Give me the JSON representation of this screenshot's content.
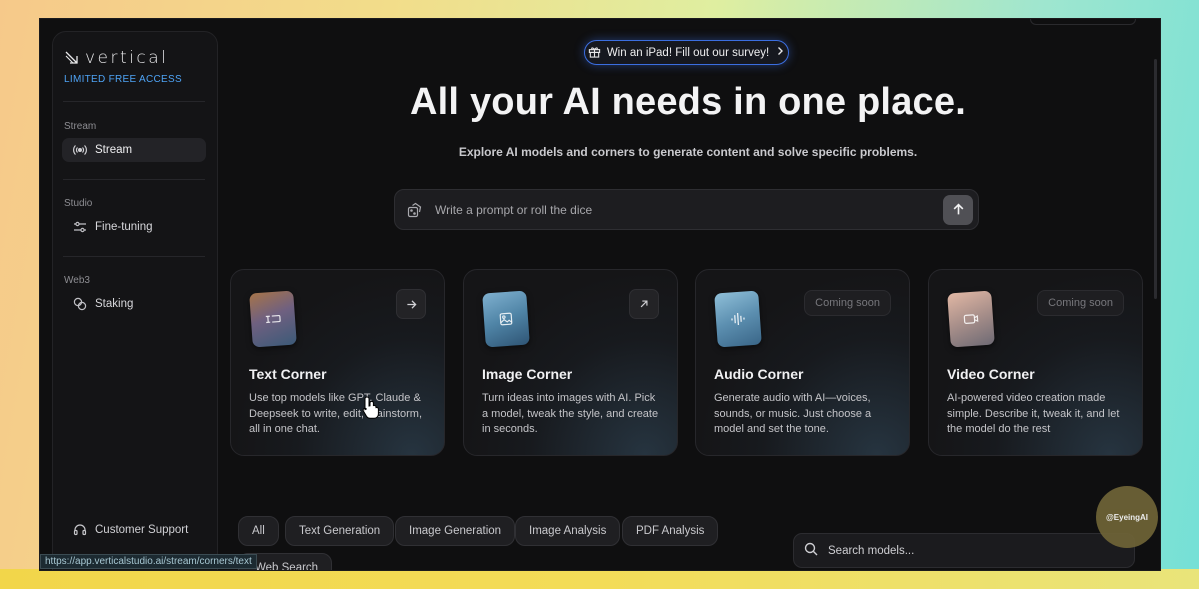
{
  "brand": {
    "name": "vertical",
    "access_label": "LIMITED FREE ACCESS"
  },
  "sidebar": {
    "sections": [
      {
        "heading": "Stream",
        "items": [
          {
            "label": "Stream",
            "icon": "broadcast-icon",
            "active": true
          }
        ]
      },
      {
        "heading": "Studio",
        "items": [
          {
            "label": "Fine-tuning",
            "icon": "sliders-icon",
            "active": false
          }
        ]
      },
      {
        "heading": "Web3",
        "items": [
          {
            "label": "Staking",
            "icon": "coins-icon",
            "active": false
          }
        ]
      }
    ],
    "support_label": "Customer Support"
  },
  "banner": {
    "text": "Win an iPad! Fill out our survey!"
  },
  "hero": {
    "title": "All your AI needs in one place.",
    "subtitle": "Explore AI models and corners to generate content and solve specific problems."
  },
  "prompt": {
    "placeholder": "Write a prompt or roll the dice"
  },
  "cards": [
    {
      "title": "Text Corner",
      "description": "Use top models like GPT, Claude & Deepseek to write, edit, brainstorm, all in one chat.",
      "status": "arrow-right-icon"
    },
    {
      "title": "Image Corner",
      "description": "Turn ideas into images with AI. Pick a model, tweak the style, and create in seconds.",
      "status": "arrow-up-right-icon"
    },
    {
      "title": "Audio Corner",
      "description": "Generate audio with AI—voices, sounds, or music. Just choose a model and set the tone.",
      "badge": "Coming soon"
    },
    {
      "title": "Video Corner",
      "description": "AI-powered video creation made simple. Describe it, tweak it, and let the model do the rest",
      "badge": "Coming soon"
    }
  ],
  "filters": [
    "All",
    "Text Generation",
    "Image Generation",
    "Image Analysis",
    "PDF Analysis",
    "Web Search"
  ],
  "model_search": {
    "placeholder": "Search models..."
  },
  "status_url": "https://app.verticalstudio.ai/stream/corners/text",
  "watermark": "@EyeingAI",
  "colors": {
    "accent": "#4ea3f5",
    "banner_border": "#3b6ee0",
    "background": "#0f0f10"
  }
}
